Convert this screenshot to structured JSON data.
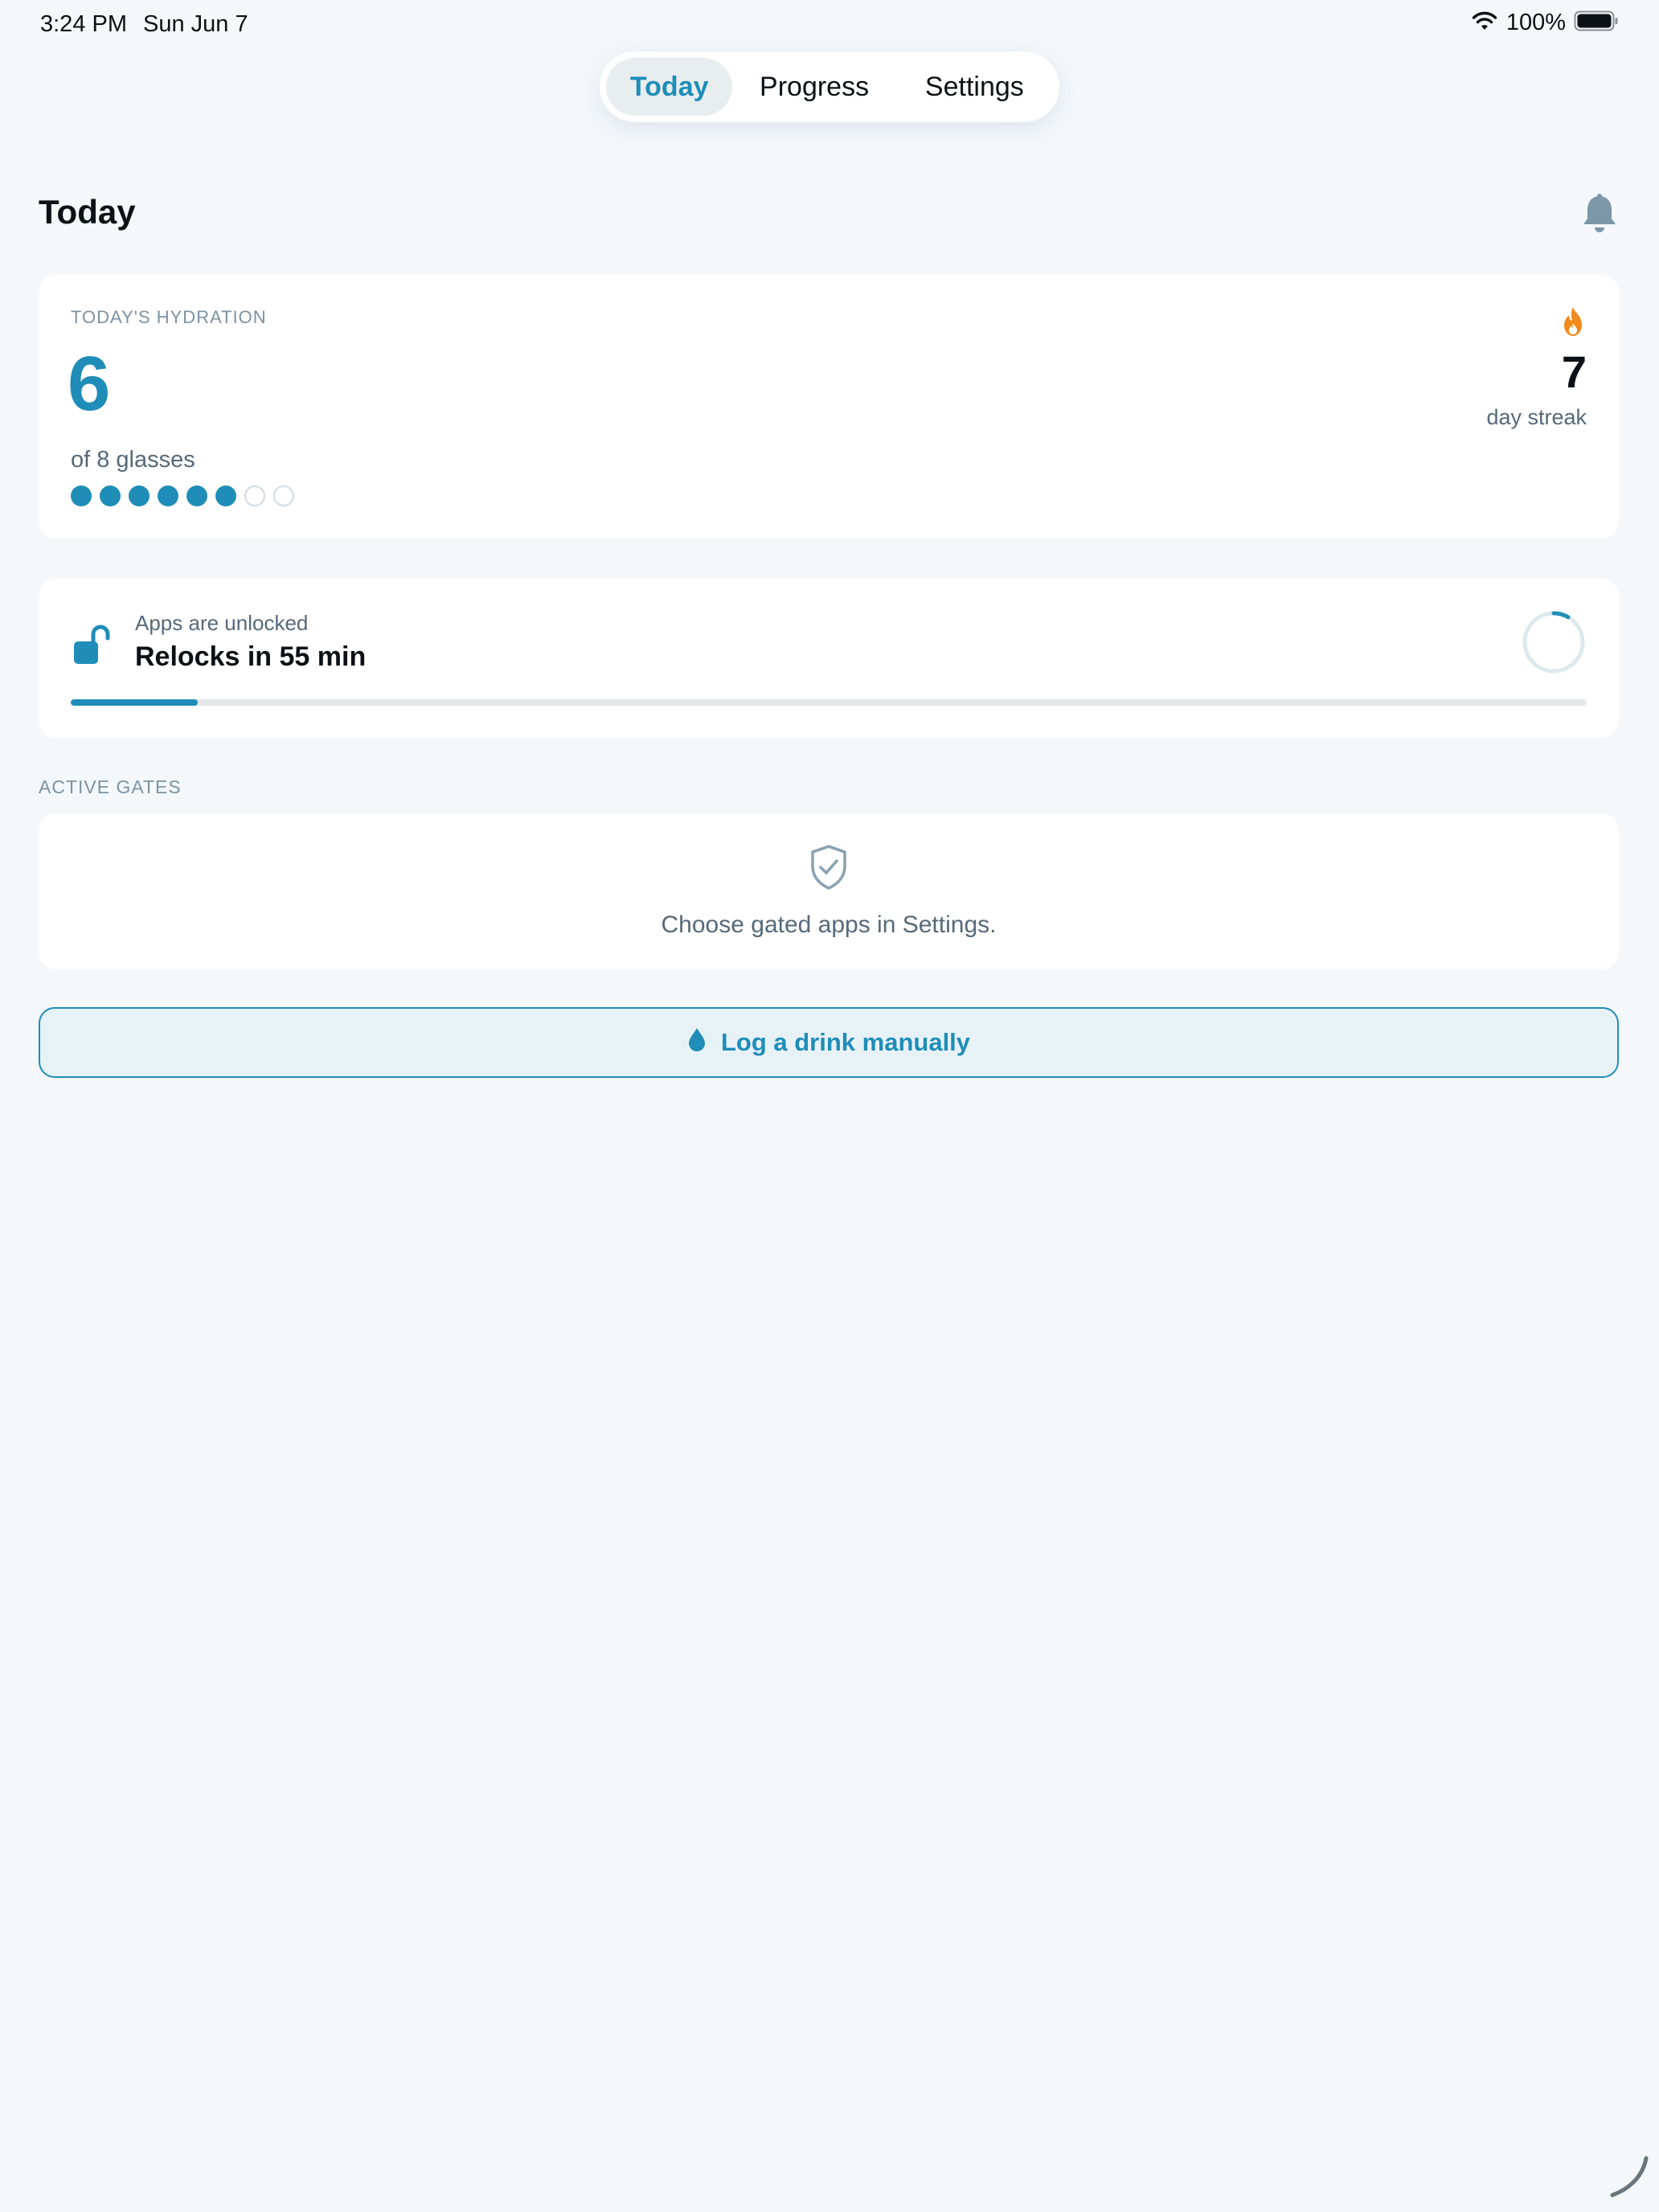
{
  "status_bar": {
    "time": "3:24 PM",
    "date": "Sun Jun 7",
    "battery": "100%"
  },
  "tabs": [
    {
      "label": "Today",
      "selected": true
    },
    {
      "label": "Progress",
      "selected": false
    },
    {
      "label": "Settings",
      "selected": false
    }
  ],
  "header": {
    "title": "Today",
    "icon": "bell-icon"
  },
  "hydration": {
    "label": "TODAY'S HYDRATION",
    "count": "6",
    "of_text": "of 8 glasses",
    "glasses_done": 6,
    "glasses_goal": 8,
    "streak_icon": "flame-icon",
    "streak_count": "7",
    "streak_label": "day streak"
  },
  "lock_status": {
    "icon": "unlocked-padlock-icon",
    "subtitle": "Apps are unlocked",
    "title": "Relocks in 55 min",
    "progress_fraction": 0.084
  },
  "active_gates": {
    "section_label": "ACTIVE GATES",
    "icon": "shield-check-icon",
    "message": "Choose gated apps in Settings."
  },
  "log_button": {
    "icon": "water-drop-icon",
    "label": "Log a drink manually"
  },
  "colors": {
    "accent": "#1f8db8",
    "streak": "#f08a1c",
    "background": "#f4f8fb",
    "card": "#ffffff",
    "muted_text": "#56697a",
    "section_label": "#7c92a4"
  }
}
